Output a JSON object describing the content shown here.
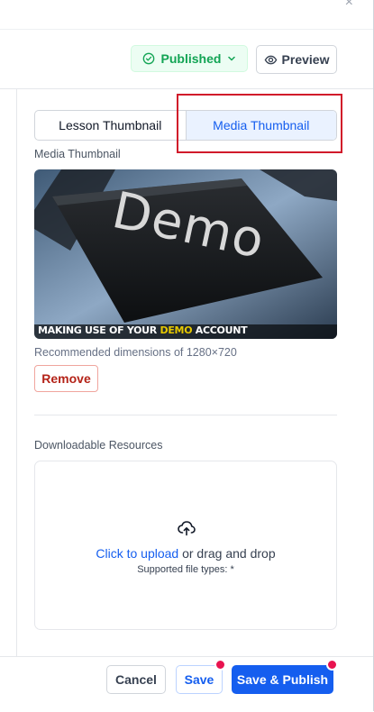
{
  "colors": {
    "accent": "#155eef",
    "published_green": "#12a454",
    "remove_red": "#b42318",
    "notification_dot": "#e8134f",
    "highlight_box": "#d11a2a"
  },
  "header": {
    "status_label": "Published",
    "status_icon": "check-circle-icon",
    "status_chevron_icon": "chevron-down-icon",
    "preview_label": "Preview",
    "preview_icon": "eye-icon",
    "close_icon": "close-icon"
  },
  "tabs": [
    {
      "label": "Lesson Thumbnail",
      "active": false
    },
    {
      "label": "Media Thumbnail",
      "active": true
    }
  ],
  "media": {
    "section_label": "Media Thumbnail",
    "image_main_text": "Demo",
    "caption_prefix": "MAKING USE OF YOUR ",
    "caption_highlight": "DEMO",
    "caption_suffix": " ACCOUNT",
    "dimensions_text": "Recommended dimensions of 1280×720",
    "remove_label": "Remove"
  },
  "resources": {
    "section_label": "Downloadable Resources",
    "upload_icon": "upload-cloud-icon",
    "upload_link": "Click to upload",
    "upload_rest": " or drag and drop",
    "file_types": "Supported file types: *"
  },
  "footer": {
    "cancel_label": "Cancel",
    "save_label": "Save",
    "save_publish_label": "Save & Publish"
  }
}
